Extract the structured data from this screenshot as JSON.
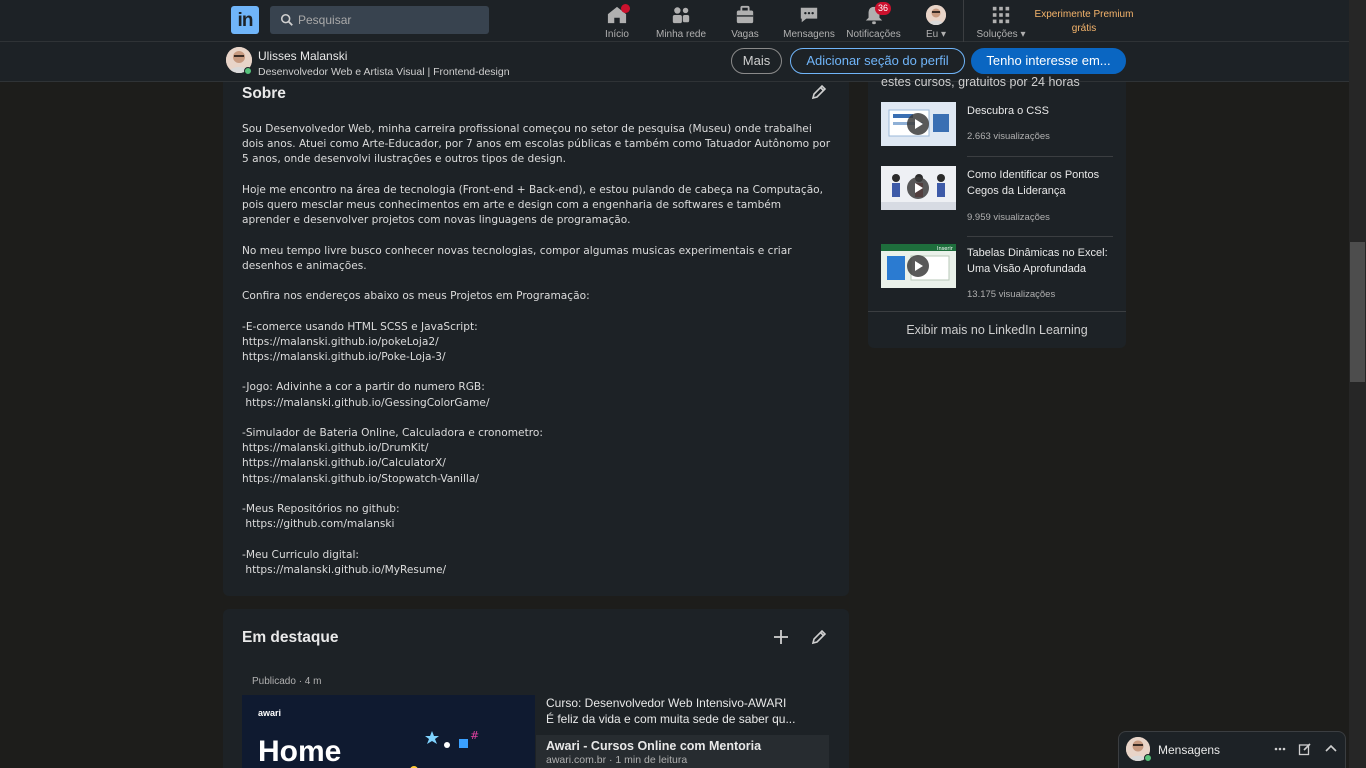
{
  "nav": {
    "logo": "in",
    "search_placeholder": "Pesquisar",
    "items": [
      {
        "label": "Início",
        "icon": "home-icon"
      },
      {
        "label": "Minha rede",
        "icon": "network-icon"
      },
      {
        "label": "Vagas",
        "icon": "briefcase-icon"
      },
      {
        "label": "Mensagens",
        "icon": "chat-icon"
      },
      {
        "label": "Notificações",
        "icon": "bell-icon",
        "badge": "36"
      },
      {
        "label": "Eu",
        "icon": "avatar"
      },
      {
        "label": "Soluções",
        "icon": "grid-icon"
      }
    ],
    "premium": "Experimente Premium grátis"
  },
  "profile_bar": {
    "name": "Ulisses Malanski",
    "headline": "Desenvolvedor Web e Artista Visual | Frontend-design",
    "more_button": "Mais",
    "add_section_button": "Adicionar seção do perfil",
    "interest_button": "Tenho interesse em..."
  },
  "about": {
    "title": "Sobre",
    "text": "Sou Desenvolvedor Web, minha carreira profissional começou no setor de pesquisa (Museu) onde trabalhei dois anos. Atuei como Arte-Educador, por 7 anos em escolas públicas e também como Tatuador Autônomo por 5 anos, onde desenvolvi ilustrações e outros tipos de design.\n\nHoje me encontro na área de tecnologia (Front-end + Back-end), e estou pulando de cabeça na Computação, pois quero mesclar meus conhecimentos em arte e design com a engenharia de softwares e também aprender e desenvolver projetos com novas linguagens de programação.\n\nNo meu tempo livre busco conhecer novas tecnologias, compor algumas musicas experimentais e criar desenhos e animações.\n\nConfira nos endereços abaixo os meus Projetos em Programação:\n\n-E-comerce usando HTML SCSS e JavaScript:\nhttps://malanski.github.io/pokeLoja2/\nhttps://malanski.github.io/Poke-Loja-3/\n\n-Jogo: Adivinhe a cor a partir do numero RGB:\n https://malanski.github.io/GessingColorGame/\n\n-Simulador de Bateria Online, Calculadora e cronometro:\nhttps://malanski.github.io/DrumKit/\nhttps://malanski.github.io/CalculatorX/\nhttps://malanski.github.io/Stopwatch-Vanilla/\n\n-Meus Repositórios no github:\n https://github.com/malanski\n\n-Meu Curriculo digital:\n https://malanski.github.io/MyResume/"
  },
  "featured": {
    "title": "Em destaque",
    "meta": "Publicado · 4 m",
    "image_brand": "awari",
    "image_text": "Home",
    "post_title": "Curso: Desenvolvedor Web Intensivo-AWARI",
    "post_excerpt": "É feliz da vida e com muita sede de saber qu...",
    "link_title": "Awari - Cursos Online com Mentoria",
    "link_meta": "awari.com.br · 1 min de leitura"
  },
  "learning": {
    "header": "estes cursos, gratuitos por 24 horas",
    "courses": [
      {
        "title": "Descubra o CSS",
        "views": "2.663 visualizações"
      },
      {
        "title": "Como Identificar os Pontos Cegos da Liderança",
        "views": "9.959 visualizações"
      },
      {
        "title": "Tabelas Dinâmicas no Excel: Uma Visão Aprofundada",
        "views": "13.175 visualizações",
        "thumb_tag": "Inserir"
      }
    ],
    "footer": "Exibir mais no LinkedIn Learning"
  },
  "messaging": {
    "label": "Mensagens"
  },
  "colors": {
    "accent": "#70b5f9",
    "primary_button": "#0a66c2",
    "premium": "#f5b46b",
    "badge": "#cb112d"
  }
}
